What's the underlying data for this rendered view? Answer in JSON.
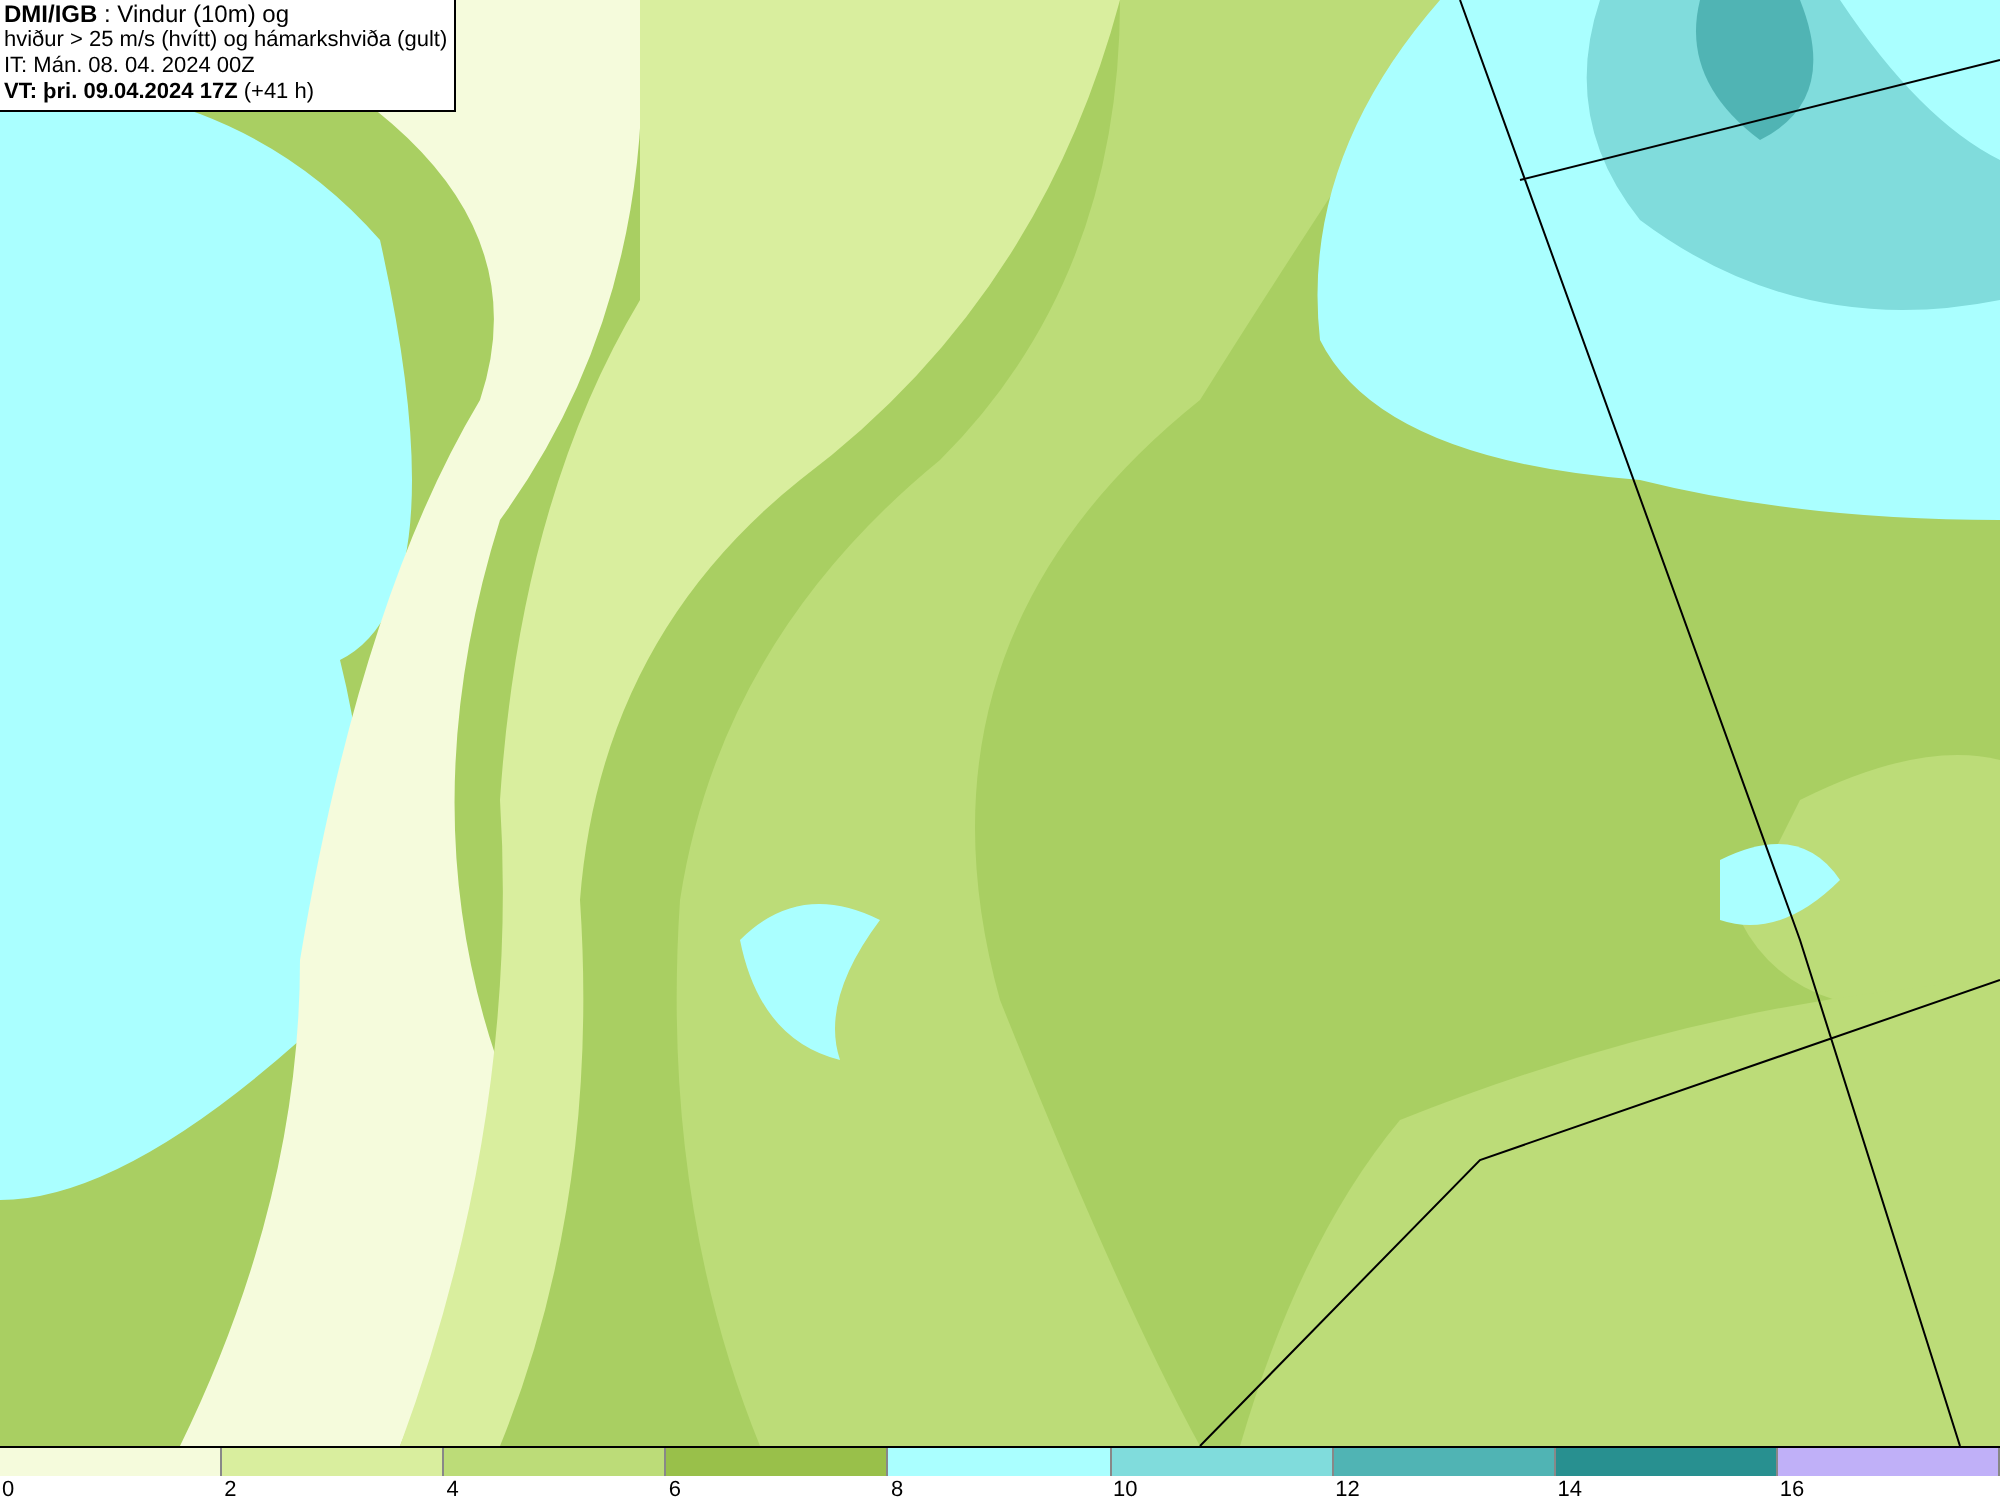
{
  "header": {
    "lines": [
      "**DMI/IGB** : Vindur (10m) og",
      "hviður > 25 m/s (hvítt) og hámarkshviða (gult)",
      "IT: Mán. 08. 04. 2024 00Z",
      "**VT: þri. 09.04.2024 17Z** (+41 h)"
    ]
  },
  "legend": [
    {
      "label": "0",
      "color": "#f5fbdc"
    },
    {
      "label": "2",
      "color": "#d9ee9e"
    },
    {
      "label": "4",
      "color": "#bcdc78"
    },
    {
      "label": "6",
      "color": "#99c04a"
    },
    {
      "label": "8",
      "color": "#aaffff"
    },
    {
      "label": "10",
      "color": "#80dcdc"
    },
    {
      "label": "12",
      "color": "#50b4b4"
    },
    {
      "label": "14",
      "color": "#289090"
    },
    {
      "label": "16",
      "color": "#c0b0f8"
    }
  ]
}
